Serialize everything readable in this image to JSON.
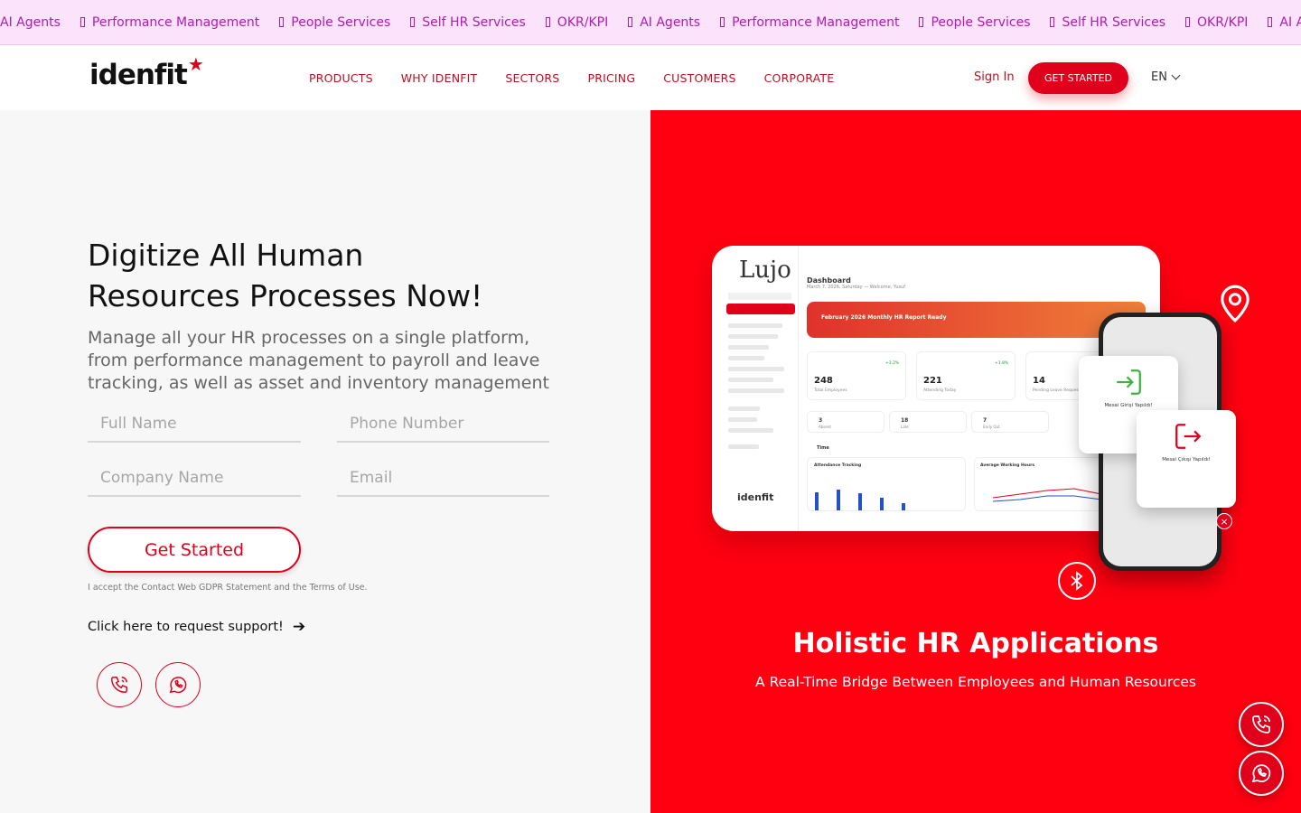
{
  "ticker": [
    "AI Agents",
    "Performance Management",
    "People Services",
    "Self HR Services",
    "OKR/KPI",
    "AI Agents",
    "Performance Management",
    "People Services",
    "Self HR Services",
    "OKR/KPI",
    "AI Agents"
  ],
  "header": {
    "logo": "idenfit",
    "nav": [
      "PRODUCTS",
      "WHY IDENFIT",
      "SECTORS",
      "PRICING",
      "CUSTOMERS",
      "CORPORATE"
    ],
    "sign_in": "Sign In",
    "get_started": "GET STARTED",
    "lang": "EN"
  },
  "hero": {
    "title_line1": "Digitize All Human",
    "title_line2": "Resources Processes Now!",
    "subtitle": "Manage all your HR processes on a single platform, from performance management to payroll and leave tracking, as well as asset and inventory management",
    "fields": {
      "full_name": "Full Name",
      "phone": "Phone Number",
      "company": "Company Name",
      "email": "Email"
    },
    "submit": "Get Started",
    "gdpr": "I accept the Contact Web GDPR Statement and the Terms of Use.",
    "support": "Click here to request support!"
  },
  "dashboard": {
    "app_logo": "Lujo",
    "title": "Dashboard",
    "date": "March 7, 2026, Saturday — Welcome, Yusuf",
    "banner": "February 2026 Monthly HR Report Ready",
    "stats": [
      {
        "value": "248",
        "label": "Total Employees",
        "badge": "+3.2%"
      },
      {
        "value": "221",
        "label": "Attending Today",
        "badge": "+1.8%"
      },
      {
        "value": "14",
        "label": "Pending Leave Requests"
      }
    ],
    "minis": [
      {
        "value": "3",
        "label": "Absent"
      },
      {
        "value": "18",
        "label": "Late"
      },
      {
        "value": "7",
        "label": "Early Out"
      }
    ],
    "section": "Time",
    "attendance": "Attendance Tracking",
    "avg_hours": "Average Working Hours",
    "footer_logo": "idenfit",
    "checkin": "Mesai Girişi Yapıldı!",
    "checkout": "Mesai Çıkışı Yapıldı!"
  },
  "promo": {
    "title": "Holistic HR Applications",
    "subtitle": "A Real-Time Bridge Between Employees and Human Resources"
  },
  "colors": {
    "brand": "#e0001b",
    "ticker_bg": "#fbe4fb",
    "ticker_text": "#b21ab2"
  }
}
